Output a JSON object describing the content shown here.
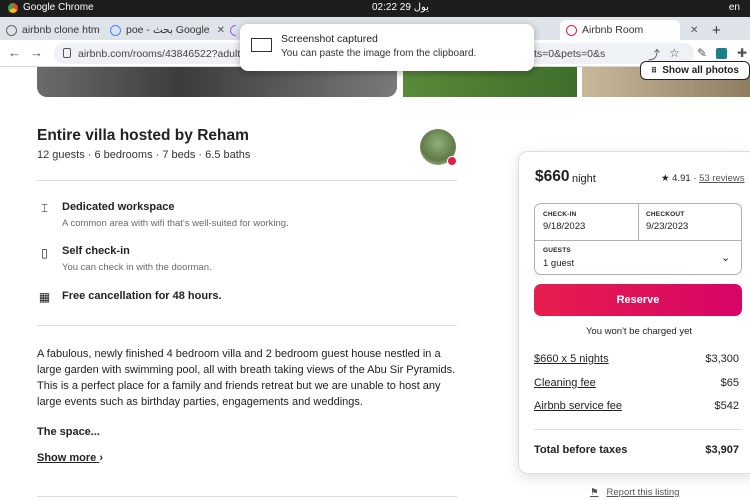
{
  "system_bar": {
    "app_name": "Google Chrome",
    "clock": "02:22  29 يول",
    "language": "en"
  },
  "tabs": [
    {
      "label": "airbnb clone htm",
      "close": "✕"
    },
    {
      "label": "poe - بحث Google",
      "close": "✕"
    },
    {
      "label": "Airbnb Room",
      "close": "✕"
    }
  ],
  "new_tab": "+",
  "url": {
    "left_text": "airbnb.com/rooms/43846522?adults=18",
    "right_text": "ts=0&pets=0&s"
  },
  "toast": {
    "title": "Screenshot captured",
    "message": "You can paste the image from the clipboard."
  },
  "photos": {
    "show_all_label": "Show all photos"
  },
  "listing": {
    "title": "Entire villa hosted by Reham",
    "summary": "12 guests · 6 bedrooms · 7 beds · 6.5 baths",
    "amenities": [
      {
        "icon": "desk-icon",
        "title": "Dedicated workspace",
        "desc": "A common area with wifi that's well-suited for working."
      },
      {
        "icon": "door-icon",
        "title": "Self check-in",
        "desc": "You can check in with the doorman."
      },
      {
        "icon": "calendar-icon",
        "title": "Free cancellation for 48 hours.",
        "desc": ""
      }
    ],
    "description": "A fabulous, newly finished 4 bedroom villa and 2 bedroom guest house nestled in a large garden with swimming pool, all with breath taking views of the Abu Sir Pyramids.\nThis is a perfect place for a family and friends retreat but we are unable to host any large events such as birthday parties, engagements and weddings.",
    "space_label": "The space...",
    "show_more": "Show more"
  },
  "booking": {
    "price": "$660",
    "price_unit": "night",
    "rating": "4.91",
    "reviews": "53 reviews",
    "checkin_label": "CHECK-IN",
    "checkin_value": "9/18/2023",
    "checkout_label": "CHECKOUT",
    "checkout_value": "9/23/2023",
    "guests_label": "GUESTS",
    "guests_value": "1 guest",
    "reserve_label": "Reserve",
    "no_charge": "You won't be charged yet",
    "fees": [
      {
        "label": "$660 x 5 nights",
        "amount": "$3,300"
      },
      {
        "label": "Cleaning fee",
        "amount": "$65"
      },
      {
        "label": "Airbnb service fee",
        "amount": "$542"
      }
    ],
    "total_label": "Total before taxes",
    "total_amount": "$3,907"
  },
  "report": {
    "label": "Report this listing"
  },
  "colors": {
    "reserve": "#e61e4d",
    "sysbar": "#1d1d1d",
    "tabbar": "#dee3ea"
  }
}
